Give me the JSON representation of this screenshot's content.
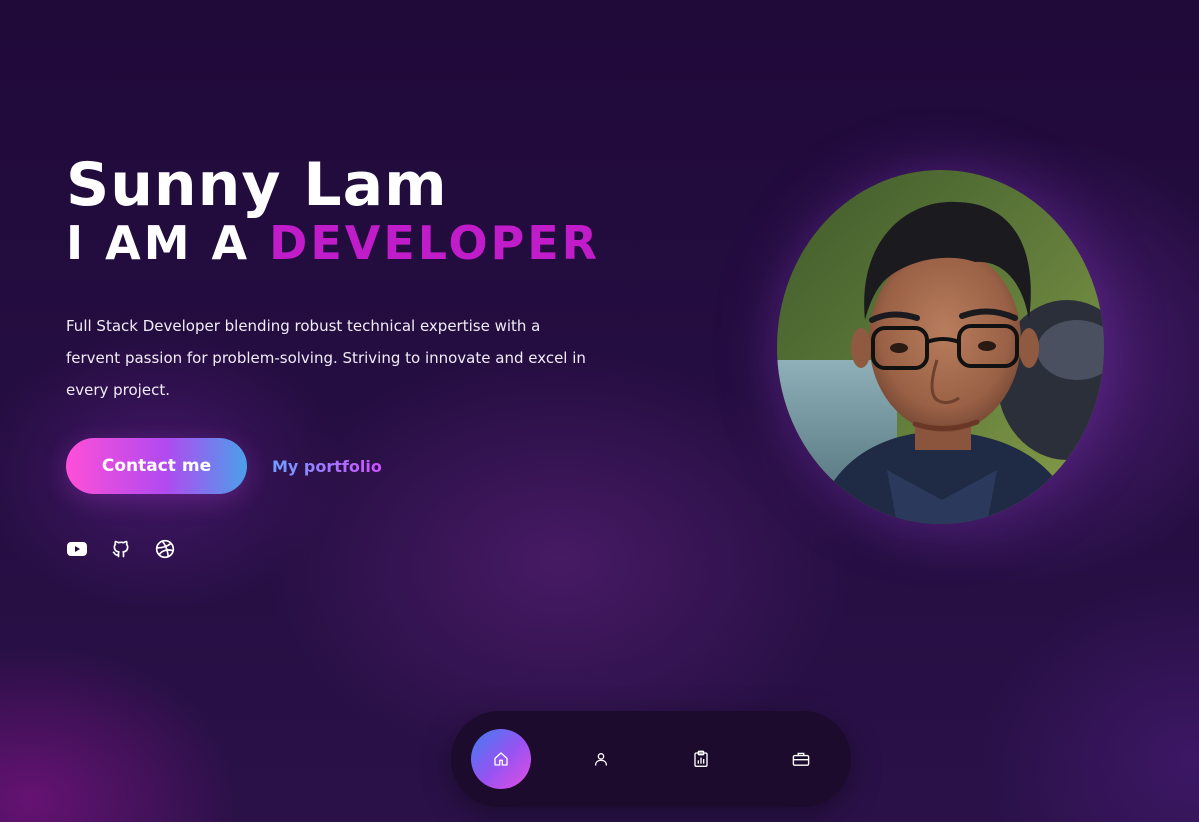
{
  "hero": {
    "name": "Sunny Lam",
    "role_prefix": "I AM A ",
    "role_highlight": "DEVELOPER",
    "description": "Full Stack Developer blending robust technical expertise with a fervent passion for problem-solving. Striving to innovate and excel in every project.",
    "contact_label": "Contact me",
    "portfolio_label": "My portfolio"
  },
  "social": [
    {
      "icon": "youtube-icon"
    },
    {
      "icon": "github-icon"
    },
    {
      "icon": "dribbble-icon"
    }
  ],
  "portrait": {
    "alt": "Portrait of Sunny Lam"
  },
  "nav": {
    "items": [
      {
        "icon": "home-icon",
        "active": true
      },
      {
        "icon": "user-icon",
        "active": false
      },
      {
        "icon": "clipboard-chart-icon",
        "active": false
      },
      {
        "icon": "briefcase-icon",
        "active": false
      }
    ]
  },
  "colors": {
    "accent": "#c11cc9",
    "button_gradient_start": "#ff4fd8",
    "button_gradient_end": "#4aa0ea",
    "background": "#220c3e",
    "nav_background": "#1c0b2c"
  }
}
